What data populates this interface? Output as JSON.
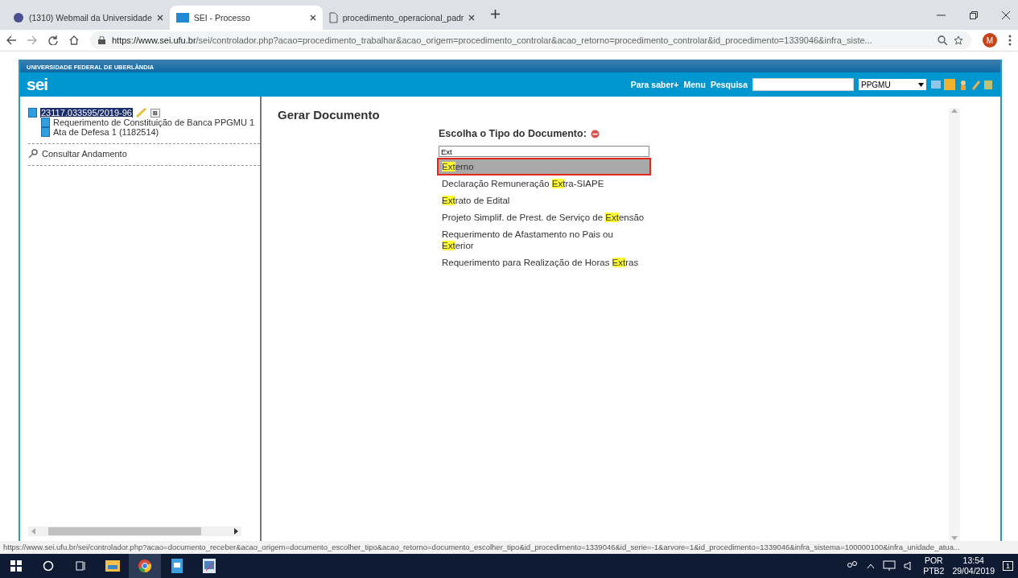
{
  "browser": {
    "tabs": [
      {
        "title": "(1310) Webmail da Universidade",
        "selected": false
      },
      {
        "title": "SEI - Processo",
        "selected": true
      },
      {
        "title": "procedimento_operacional_padr",
        "selected": false
      }
    ],
    "url_host": "https://www.sei.ufu.br",
    "url_path": "/sei/controlador.php?acao=procedimento_trabalhar&acao_origem=procedimento_controlar&acao_retorno=procedimento_controlar&id_procedimento=1339046&infra_siste...",
    "avatar": "M"
  },
  "header": {
    "institution": "UNIVERSIDADE FEDERAL DE UBERLÂNDIA",
    "logo": "sei",
    "links": [
      "Para saber+",
      "Menu",
      "Pesquisa"
    ],
    "unit": "PPGMU"
  },
  "tree": {
    "process": "23117.033595/2019-96",
    "badge": "B",
    "children": [
      {
        "label": "Requerimento de Constituição de Banca PPGMU 1"
      },
      {
        "label": "Ata de Defesa 1 (1182514)"
      }
    ],
    "action": "Consultar Andamento"
  },
  "content": {
    "title": "Gerar Documento",
    "prompt": "Escolha o Tipo do Documento:",
    "filter": "Ext",
    "options": [
      {
        "match": "Ext",
        "after": "erno",
        "selected": true
      },
      {
        "before": "Declaração Remuneração ",
        "match": "Ext",
        "after": "ra-SIAPE",
        "selected": false
      },
      {
        "match": "Ext",
        "after": "rato de Edital",
        "selected": false
      },
      {
        "before": "Projeto Simplif. de Prest. de Serviço de ",
        "match": "Ext",
        "after": "ensão",
        "selected": false
      },
      {
        "before": "Requerimento de Afastamento no Pais ou ",
        "match": "Ext",
        "after": "erior",
        "selected": false
      },
      {
        "before": "Requerimento para Realização de Horas ",
        "match": "Ext",
        "after": "ras",
        "selected": false
      }
    ]
  },
  "status_url": "https://www.sei.ufu.br/sei/controlador.php?acao=documento_receber&acao_origem=documento_escolher_tipo&acao_retorno=documento_escolher_tipo&id_procedimento=1339046&id_serie=-1&arvore=1&id_procedimento=1339046&infra_sistema=100000100&infra_unidade_atua...",
  "taskbar": {
    "language": "POR",
    "layout": "PTB2",
    "time": "13:54",
    "date": "29/04/2019",
    "notifications": "1"
  }
}
